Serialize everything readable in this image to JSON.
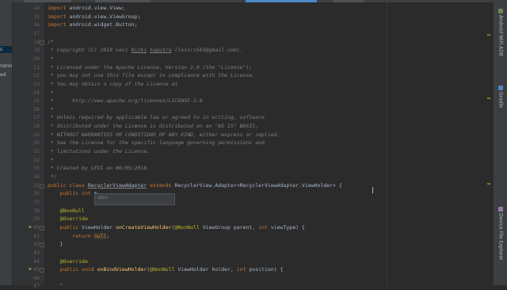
{
  "left_panel": {
    "items": [
      "",
      "",
      "",
      "",
      "",
      "",
      "",
      "",
      "",
      "",
      "",
      "",
      "",
      "",
      "",
      "",
      "",
      "",
      "",
      "",
      "",
      "",
      "",
      "",
      "",
      "",
      "",
      "",
      "",
      "",
      "",
      "",
      ""
    ],
    "visible_labels": [
      {
        "text": "s",
        "row": 7
      },
      {
        "text": "ndroidT",
        "row": 9
      },
      {
        "text": "ed",
        "row": 10
      }
    ]
  },
  "editor": {
    "lines": [
      {
        "no": "14",
        "tokens": [
          {
            "t": "import ",
            "c": "kw"
          },
          {
            "t": "android.view.View;",
            "c": ""
          }
        ]
      },
      {
        "no": "15",
        "tokens": [
          {
            "t": "import ",
            "c": "kw"
          },
          {
            "t": "android.view.ViewGroup;",
            "c": ""
          }
        ]
      },
      {
        "no": "16",
        "tokens": [
          {
            "t": "import ",
            "c": "kw"
          },
          {
            "t": "android.widget.Button;",
            "c": ""
          }
        ]
      },
      {
        "no": "17",
        "tokens": []
      },
      {
        "no": "18",
        "tokens": [
          {
            "t": "/*",
            "c": "cm"
          }
        ]
      },
      {
        "no": "19",
        "tokens": [
          {
            "t": " * Copyright (C) 2018 Levi ",
            "c": "cm"
          },
          {
            "t": "Rizki",
            "c": "cm u"
          },
          {
            "t": " ",
            "c": "cm"
          },
          {
            "t": "Saputra",
            "c": "cm u"
          },
          {
            "t": " (levirs565@gmail.com).",
            "c": "cm"
          }
        ]
      },
      {
        "no": "20",
        "tokens": [
          {
            "t": " *",
            "c": "cm"
          }
        ]
      },
      {
        "no": "21",
        "tokens": [
          {
            "t": " * Licensed under the Apache License, Version 2.0 (the \"License\");",
            "c": "cm"
          }
        ]
      },
      {
        "no": "22",
        "tokens": [
          {
            "t": " * you may not use this file except in compliance with the License.",
            "c": "cm"
          }
        ]
      },
      {
        "no": "23",
        "tokens": [
          {
            "t": " * You may obtain a copy of the License at",
            "c": "cm"
          }
        ]
      },
      {
        "no": "24",
        "tokens": [
          {
            "t": " *",
            "c": "cm"
          }
        ]
      },
      {
        "no": "25",
        "tokens": [
          {
            "t": " *      http://www.apache.org/licenses/LICENSE-2.0",
            "c": "cm"
          }
        ]
      },
      {
        "no": "26",
        "tokens": [
          {
            "t": " *",
            "c": "cm"
          }
        ]
      },
      {
        "no": "27",
        "tokens": [
          {
            "t": " * Unless required by applicable law or agreed to in writing, software",
            "c": "cm"
          }
        ]
      },
      {
        "no": "28",
        "tokens": [
          {
            "t": " * distributed under the License is distributed on an \"AS IS\" BASIS,",
            "c": "cm"
          }
        ]
      },
      {
        "no": "29",
        "tokens": [
          {
            "t": " * WITHOUT WARRANTIES OR CONDITIONS OF ANY KIND, either express or implied.",
            "c": "cm"
          }
        ]
      },
      {
        "no": "30",
        "tokens": [
          {
            "t": " * See the License for the specific language governing permissions and",
            "c": "cm"
          }
        ]
      },
      {
        "no": "31",
        "tokens": [
          {
            "t": " * limitations under the License.",
            "c": "cm"
          }
        ]
      },
      {
        "no": "32",
        "tokens": [
          {
            "t": " *",
            "c": "cm"
          }
        ]
      },
      {
        "no": "33",
        "tokens": [
          {
            "t": " * Created by LEVI on 06/05/2018.",
            "c": "cm"
          }
        ]
      },
      {
        "no": "34",
        "tokens": [
          {
            "t": " */",
            "c": "cm"
          }
        ]
      },
      {
        "no": "35",
        "tokens": [
          {
            "t": "public class ",
            "c": "kw"
          },
          {
            "t": "RecyclerViewAdapter",
            "c": "u"
          },
          {
            "t": " extends ",
            "c": "kw"
          },
          {
            "t": "RecyclerView.Adapter<RecyclerViewAdapter.ViewHolder> {",
            "c": ""
          }
        ]
      },
      {
        "no": "36",
        "tokens": [
          {
            "t": "    public int ",
            "c": "kw"
          },
          {
            "t": "m",
            "c": ""
          }
        ]
      },
      {
        "no": "37",
        "tokens": []
      },
      {
        "no": "38",
        "tokens": [
          {
            "t": "    @NonNull",
            "c": "an"
          }
        ]
      },
      {
        "no": "39",
        "tokens": [
          {
            "t": "    @Override",
            "c": "an"
          }
        ]
      },
      {
        "no": "40",
        "tokens": [
          {
            "t": "    public ",
            "c": "kw"
          },
          {
            "t": "ViewHolder ",
            "c": ""
          },
          {
            "t": "onCreateViewHolder",
            "c": "fn"
          },
          {
            "t": "(",
            "c": ""
          },
          {
            "t": "@NonNull",
            "c": "an"
          },
          {
            "t": " ViewGroup parent, ",
            "c": ""
          },
          {
            "t": "int ",
            "c": "kw"
          },
          {
            "t": "viewType) {",
            "c": ""
          }
        ]
      },
      {
        "no": "41",
        "tokens": [
          {
            "t": "        return ",
            "c": "kw"
          },
          {
            "t": "null",
            "c": "nullhl"
          },
          {
            "t": ";",
            "c": ""
          }
        ]
      },
      {
        "no": "42",
        "tokens": [
          {
            "t": "    }",
            "c": ""
          }
        ]
      },
      {
        "no": "43",
        "tokens": []
      },
      {
        "no": "44",
        "tokens": [
          {
            "t": "    @Override",
            "c": "an"
          }
        ]
      },
      {
        "no": "45",
        "tokens": [
          {
            "t": "    public void ",
            "c": "kw"
          },
          {
            "t": "onBindViewHolder",
            "c": "fn"
          },
          {
            "t": "(",
            "c": ""
          },
          {
            "t": "@NonNull",
            "c": "an"
          },
          {
            "t": " ViewHolder holder, ",
            "c": ""
          },
          {
            "t": "int ",
            "c": "kw"
          },
          {
            "t": "position) {",
            "c": ""
          }
        ]
      },
      {
        "no": "46",
        "tokens": []
      },
      {
        "no": "47",
        "tokens": [
          {
            "t": "    }",
            "c": ""
          }
        ]
      }
    ],
    "completion_popup": {
      "item": "mInt"
    }
  },
  "right_strip": {
    "tabs": [
      {
        "label": "Android WiFi ADB",
        "icon": "wifi-adb-icon",
        "color": "#6a8759"
      },
      {
        "label": "Gradle",
        "icon": "gradle-icon",
        "color": "#4a88c7"
      },
      {
        "label": "Device File Explorer",
        "icon": "device-file-explorer-icon",
        "color": "#9876aa"
      }
    ]
  },
  "colors": {
    "background": "#2b2b2b",
    "keyword": "#cc7832",
    "comment": "#808080",
    "annotation": "#bbb529",
    "method": "#ffc66d",
    "text": "#a9b7c6"
  }
}
